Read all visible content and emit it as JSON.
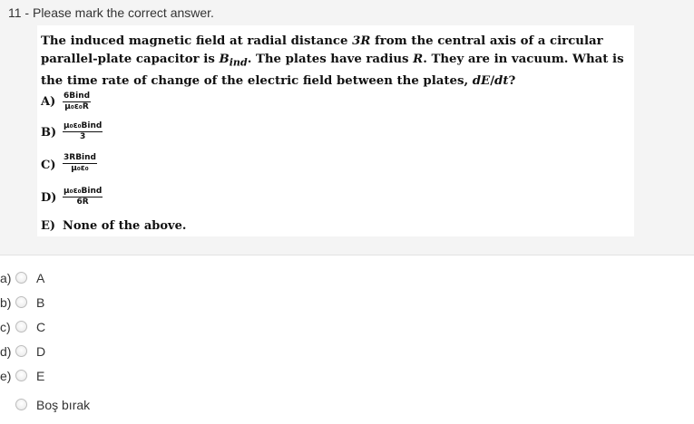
{
  "question": {
    "header": "11 - Please mark the correct answer.",
    "stem": {
      "p1": "The induced magnetic field at radial distance ",
      "v1": "3R",
      "p2": " from the central axis of a circular parallel-plate capacitor is ",
      "v2": "B",
      "v2_sub": "ind",
      "p3": ". The plates have radius ",
      "v3": "R",
      "p4": ". They are in vacuum. What is the time rate of change of the electric field between the plates, ",
      "v4": "dE",
      "p5": "/",
      "v5": "dt",
      "p6": "?"
    },
    "choices": [
      {
        "letter": "A)",
        "num": "6Bind",
        "den": "μ₀ε₀R"
      },
      {
        "letter": "B)",
        "num": "μ₀ε₀Bind",
        "den": "3"
      },
      {
        "letter": "C)",
        "num": "3RBind",
        "den": "μ₀ε₀"
      },
      {
        "letter": "D)",
        "num": "μ₀ε₀Bind",
        "den": "6R"
      },
      {
        "letter": "E)",
        "text": "None of the above."
      }
    ]
  },
  "answer_options": [
    {
      "key": "a)",
      "label": "A"
    },
    {
      "key": "b)",
      "label": "B"
    },
    {
      "key": "c)",
      "label": "C"
    },
    {
      "key": "d)",
      "label": "D"
    },
    {
      "key": "e)",
      "label": "E"
    },
    {
      "key": "",
      "label": "Boş bırak"
    }
  ]
}
